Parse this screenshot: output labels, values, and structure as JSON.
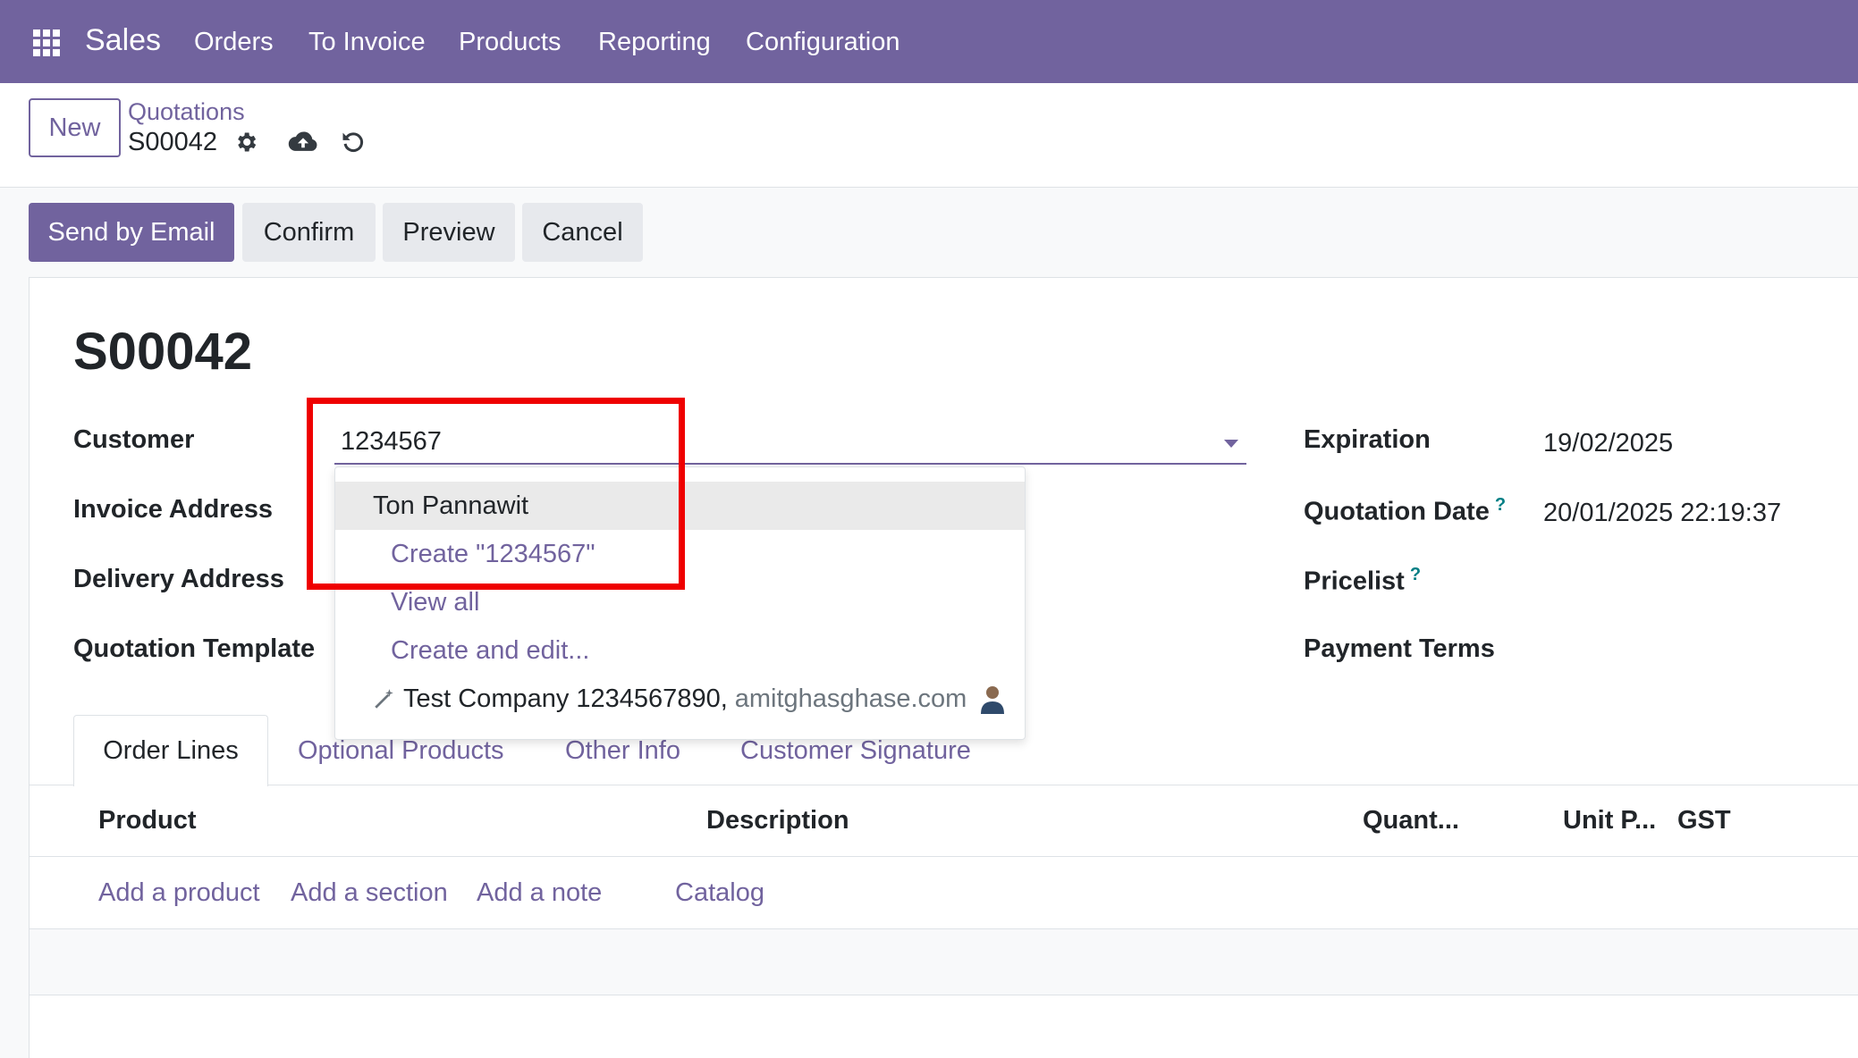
{
  "navbar": {
    "apps_icon": "grid-icon",
    "brand": "Sales",
    "menu": [
      "Orders",
      "To Invoice",
      "Products",
      "Reporting",
      "Configuration"
    ]
  },
  "control_panel": {
    "new_label": "New",
    "breadcrumb_parent": "Quotations",
    "breadcrumb_current": "S00042",
    "icons": [
      "gear-icon",
      "cloud-upload-icon",
      "undo-icon"
    ]
  },
  "actions": {
    "send_by_email": "Send by Email",
    "confirm": "Confirm",
    "preview": "Preview",
    "cancel": "Cancel"
  },
  "form": {
    "record_name": "S00042",
    "labels": {
      "customer": "Customer",
      "invoice_address": "Invoice Address",
      "delivery_address": "Delivery Address",
      "quotation_template": "Quotation Template",
      "expiration": "Expiration",
      "quotation_date": "Quotation Date",
      "pricelist": "Pricelist",
      "payment_terms": "Payment Terms"
    },
    "help_mark": "?",
    "customer_value": "1234567",
    "expiration_value": "19/02/2025",
    "quotation_date_value": "20/01/2025 22:19:37"
  },
  "dropdown": {
    "highlighted": "Ton Pannawit",
    "create": "Create \"1234567\"",
    "view_all": "View all",
    "create_edit": "Create and edit...",
    "company_name": "Test Company 1234567890,",
    "company_email": "amitghasghase.com"
  },
  "tabs": [
    "Order Lines",
    "Optional Products",
    "Other Info",
    "Customer Signature"
  ],
  "table": {
    "headers": [
      "Product",
      "Description",
      "Quant...",
      "Unit P...",
      "GST"
    ],
    "add_links": [
      "Add a product",
      "Add a section",
      "Add a note",
      "Catalog"
    ]
  },
  "colors": {
    "brand": "#71639e",
    "highlight_box": "#ef0000"
  }
}
